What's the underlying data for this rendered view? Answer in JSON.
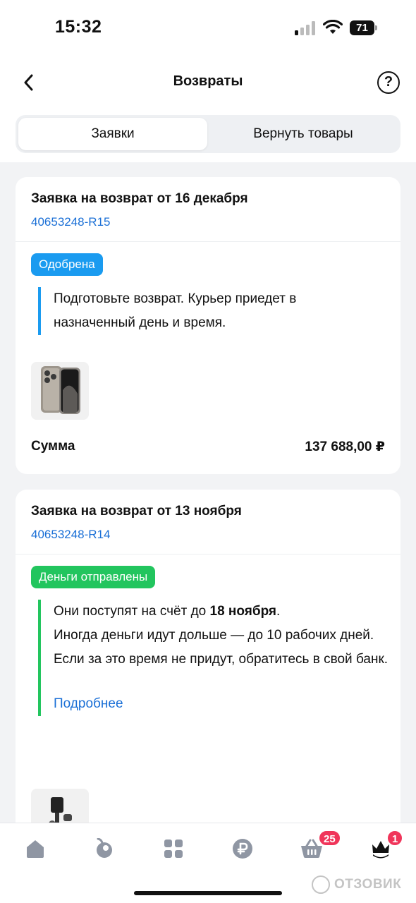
{
  "status_bar": {
    "time": "15:32",
    "battery": "71"
  },
  "header": {
    "title": "Возвраты",
    "help": "?"
  },
  "tabs": [
    {
      "label": "Заявки",
      "active": true
    },
    {
      "label": "Вернуть товары",
      "active": false
    }
  ],
  "returns": [
    {
      "title": "Заявка на возврат от 16 декабря",
      "number": "40653248-R15",
      "status": "Одобрена",
      "status_color": "#1a9bf0",
      "message": "Подготовьте возврат. Курьер приедет в назначенный день и время.",
      "sum_label": "Сумма",
      "sum_value": "137 688,00 ₽"
    },
    {
      "title": "Заявка на возврат от 13 ноября",
      "number": "40653248-R14",
      "status": "Деньги отправлены",
      "status_color": "#22c55e",
      "message_prefix": "Они поступят на счёт до ",
      "message_bold": "18 ноября",
      "message_suffix": ".",
      "message_line2": "Иногда деньги идут дольше — до 10 рабочих дней.",
      "message_line3": "Если за это время не придут, обратитесь в свой банк.",
      "more_link": "Подробнее"
    }
  ],
  "bottom_nav": {
    "items": [
      {
        "icon": "home-icon"
      },
      {
        "icon": "catalog-fruit-icon"
      },
      {
        "icon": "grid-icon"
      },
      {
        "icon": "ruble-icon"
      },
      {
        "icon": "basket-icon",
        "badge": "25"
      },
      {
        "icon": "profile-crown-icon",
        "badge": "1"
      }
    ],
    "accent": "#f0355a"
  },
  "watermark": "ОТЗОВИК"
}
